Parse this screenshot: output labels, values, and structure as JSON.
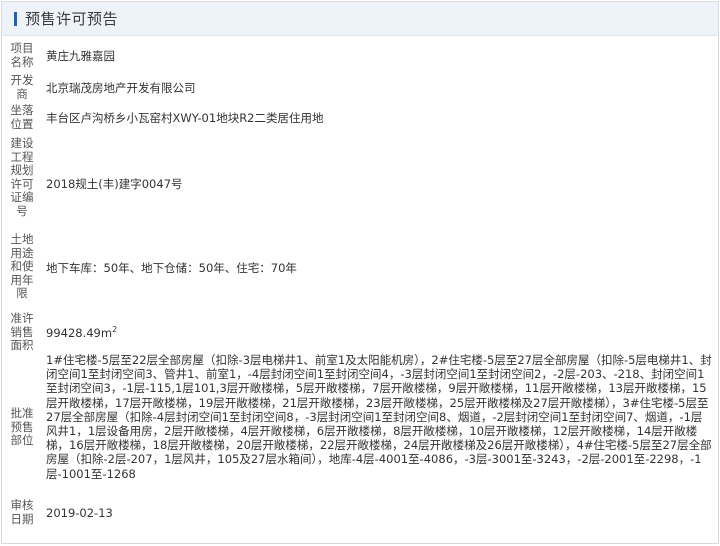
{
  "panel": {
    "title": "预售许可预告"
  },
  "fields": {
    "project_name": {
      "label": "项目名称",
      "value": "黄庄九雅嘉园"
    },
    "developer": {
      "label": "开发商",
      "value": "北京瑞茂房地产开发有限公司"
    },
    "location": {
      "label": "坐落位置",
      "value": "丰台区卢沟桥乡小瓦窑村XWY-01地块R2二类居住用地"
    },
    "permit_no": {
      "label": "建设工程规划许可证编号",
      "value": "2018规土(丰)建字0047号"
    },
    "land_use": {
      "label": "土地用途和使用年限",
      "value": "地下车库：50年、地下仓储：50年、住宅：70年"
    },
    "sale_area": {
      "label": "准许销售面积",
      "value": "99428.49m",
      "unit_sup": "2"
    },
    "approved_parts": {
      "label": "批准预售部位",
      "value": "1#住宅楼-5层至22层全部房屋（扣除-3层电梯井1、前室1及太阳能机房），2#住宅楼-5层至27层全部房屋（扣除-5层电梯井1、封闭空间1至封闭空间3、管井1、前室1，-4层封闭空间1至封闭空间4，-3层封闭空间1至封闭空间2，-2层-203、-218、封闭空间1至封闭空间3，-1层-115,1层101,3层开敞楼梯，5层开敞楼梯，7层开敞楼梯，9层开敞楼梯，11层开敞楼梯，13层开敞楼梯，15层开敞楼梯，17层开敞楼梯，19层开敞楼梯，21层开敞楼梯，23层开敞楼梯，25层开敞楼梯及27层开敞楼梯），3#住宅楼-5层至27层全部房屋（扣除-4层封闭空间1至封闭空间8，-3层封闭空间1至封闭空间8、烟道，-2层封闭空间1至封闭空间7、烟道，-1层风井1，1层设备用房，2层开敞楼梯，4层开敞楼梯，6层开敞楼梯，8层开敞楼梯，10层开敞楼梯，12层开敞楼梯，14层开敞楼梯，16层开敞楼梯，18层开敞楼梯，20层开敞楼梯，22层开敞楼梯，24层开敞楼梯及26层开敞楼梯），4#住宅楼-5层至27层全部房屋（扣除-2层-207，1层风井，105及27层水箱间），地库-4层-4001至-4086，-3层-3001至-3243，-2层-2001至-2298，-1层-1001至-1268"
    },
    "review_date": {
      "label": "审核日期",
      "value": "2019-02-13"
    }
  }
}
